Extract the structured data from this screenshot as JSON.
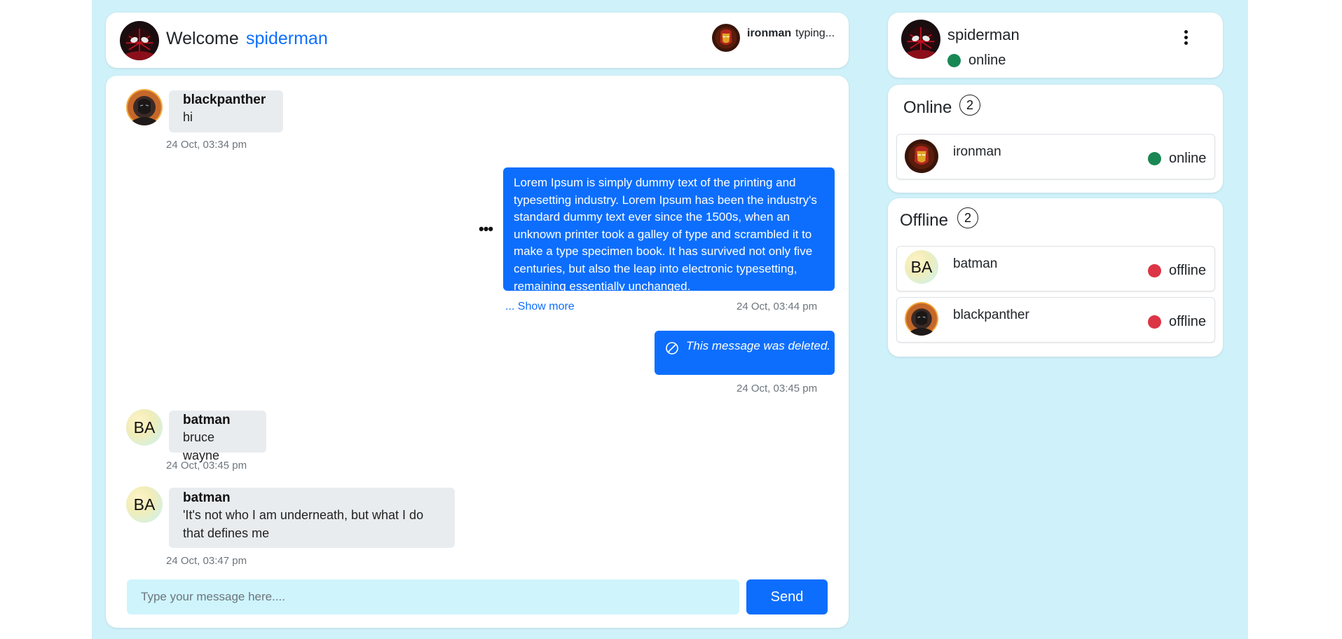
{
  "colors": {
    "page_bg": "#cff1f9",
    "primary": "#0d6efd",
    "online": "#198754",
    "offline": "#dc3545",
    "incoming_bubble": "#e9ecef"
  },
  "header": {
    "welcome": "Welcome",
    "username": "spiderman",
    "typing_user": "ironman",
    "typing_text": "typing..."
  },
  "messages": [
    {
      "sender": "blackpanther",
      "text": "hi",
      "time": "24 Oct, 03:34 pm",
      "avatar": "blackpanther"
    },
    {
      "text": "Lorem Ipsum is simply dummy text of the printing and typesetting industry. Lorem Ipsum has been the industry's standard dummy text ever since the 1500s, when an unknown printer took a galley of type and scrambled it to make a type specimen book. It has survived not only five centuries, but also the leap into electronic typesetting, remaining essentially unchanged.",
      "show_more": "... Show more",
      "time": "24 Oct, 03:44 pm",
      "options_icon": "more-horizontal-icon"
    },
    {
      "text": "This message was deleted.",
      "time": "24 Oct, 03:45 pm",
      "icon": "block-icon"
    },
    {
      "sender": "batman",
      "text": "bruce wayne",
      "time": "24 Oct, 03:45 pm",
      "avatar_initials": "BA"
    },
    {
      "sender": "batman",
      "text": "'It's not who I am underneath, but what I do that defines me",
      "time": "24 Oct, 03:47 pm",
      "avatar_initials": "BA"
    }
  ],
  "composer": {
    "placeholder": "Type your message here....",
    "send_label": "Send"
  },
  "profile": {
    "name": "spiderman",
    "status": "online",
    "menu_icon": "kebab-menu-icon"
  },
  "online_section": {
    "title": "Online",
    "count": "2",
    "users": [
      {
        "name": "ironman",
        "status": "online"
      }
    ]
  },
  "offline_section": {
    "title": "Offline",
    "count": "2",
    "users": [
      {
        "name": "batman",
        "status": "offline",
        "initials": "BA"
      },
      {
        "name": "blackpanther",
        "status": "offline"
      }
    ]
  }
}
